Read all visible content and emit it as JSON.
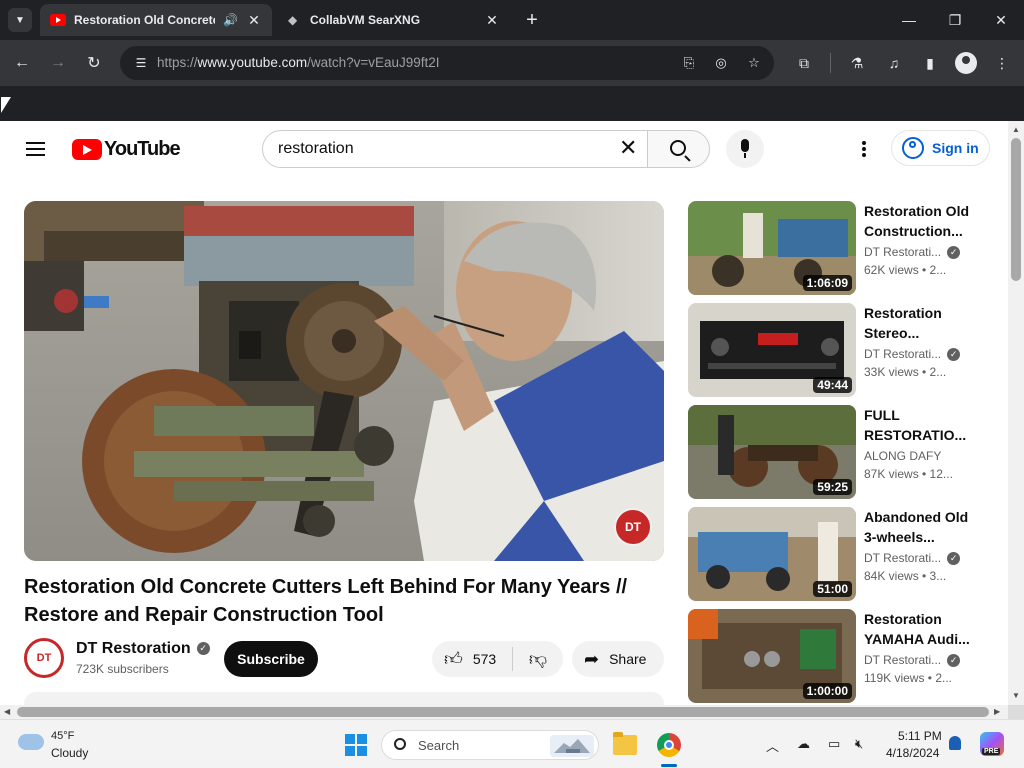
{
  "browser": {
    "tabs": [
      {
        "title": "Restoration Old Concrete C",
        "active": true,
        "audio": true
      },
      {
        "title": "CollabVM SearXNG",
        "active": false
      }
    ],
    "url_scheme": "https://",
    "url_host": "www.youtube.com",
    "url_path": "/watch?v=vEauJ99ft2I"
  },
  "youtube": {
    "logo_text": "YouTube",
    "search_query": "restoration",
    "signin_label": "Sign in",
    "video": {
      "title": "Restoration Old Concrete Cutters Left Behind For Many Years // Restore and Repair Construction Tool",
      "channel": "DT Restoration",
      "channel_avatar_text": "DT",
      "subscribers": "723K subscribers",
      "subscribe_label": "Subscribe",
      "likes": "573",
      "share_label": "Share",
      "watermark_text": "DT"
    },
    "recommendations": [
      {
        "title": "Restoration Old Construction...",
        "channel": "DT Restorati...",
        "verified": true,
        "meta": "62K views • 2...",
        "duration": "1:06:09"
      },
      {
        "title": "Restoration Stereo...",
        "channel": "DT Restorati...",
        "verified": true,
        "meta": "33K views • 2...",
        "duration": "49:44"
      },
      {
        "title": "FULL RESTORATIO...",
        "channel": "ALONG DAFY",
        "verified": false,
        "meta": "87K views • 12...",
        "duration": "59:25"
      },
      {
        "title": "Abandoned Old 3-wheels...",
        "channel": "DT Restorati...",
        "verified": true,
        "meta": "84K views • 3...",
        "duration": "51:00"
      },
      {
        "title": "Restoration YAMAHA Audi...",
        "channel": "DT Restorati...",
        "verified": true,
        "meta": "119K views • 2...",
        "duration": "1:00:00"
      }
    ]
  },
  "taskbar": {
    "weather_temp": "45°F",
    "weather_cond": "Cloudy",
    "search_label": "Search",
    "time": "5:11 PM",
    "date": "4/18/2024",
    "copilot_badge": "PRE"
  },
  "colors": {
    "yt_red": "#ff0000",
    "link_blue": "#065fd4",
    "chrome_dark": "#202124",
    "chrome_toolbar": "#35363a"
  }
}
